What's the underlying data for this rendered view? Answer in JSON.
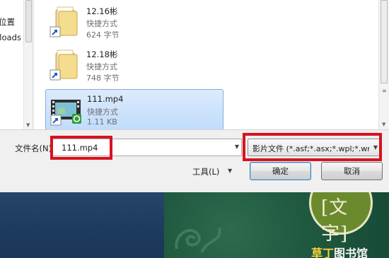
{
  "dialog": {
    "nav_pane": {
      "items": [
        {
          "label": "位置"
        },
        {
          "label": "nloads"
        }
      ]
    },
    "files": [
      {
        "name": "12.16彬",
        "type": "快捷方式",
        "size": "624 字节",
        "icon": "folder-shortcut-icon",
        "selected": false
      },
      {
        "name": "12.18彬",
        "type": "快捷方式",
        "size": "748 字节",
        "icon": "folder-shortcut-icon",
        "selected": false
      },
      {
        "name": "111.mp4",
        "type": "快捷方式",
        "size": "1.11 KB",
        "icon": "video-shortcut-icon",
        "selected": true
      }
    ],
    "filename": {
      "label": "文件名(N):",
      "value": "111.mp4"
    },
    "filetype": {
      "selected": "影片文件 (*.asf;*.asx;*.wpl;*.wm"
    },
    "tools_label": "工具(L)",
    "ok_label": "确定",
    "cancel_label": "取消"
  },
  "background": {
    "badge_text": "[文字]",
    "watermark": {
      "accent": "草丁",
      "rest": "图书馆"
    }
  },
  "colors": {
    "highlight": "#d9121f",
    "selection": "#c1dcfc",
    "accent_green": "#1f5a40"
  }
}
